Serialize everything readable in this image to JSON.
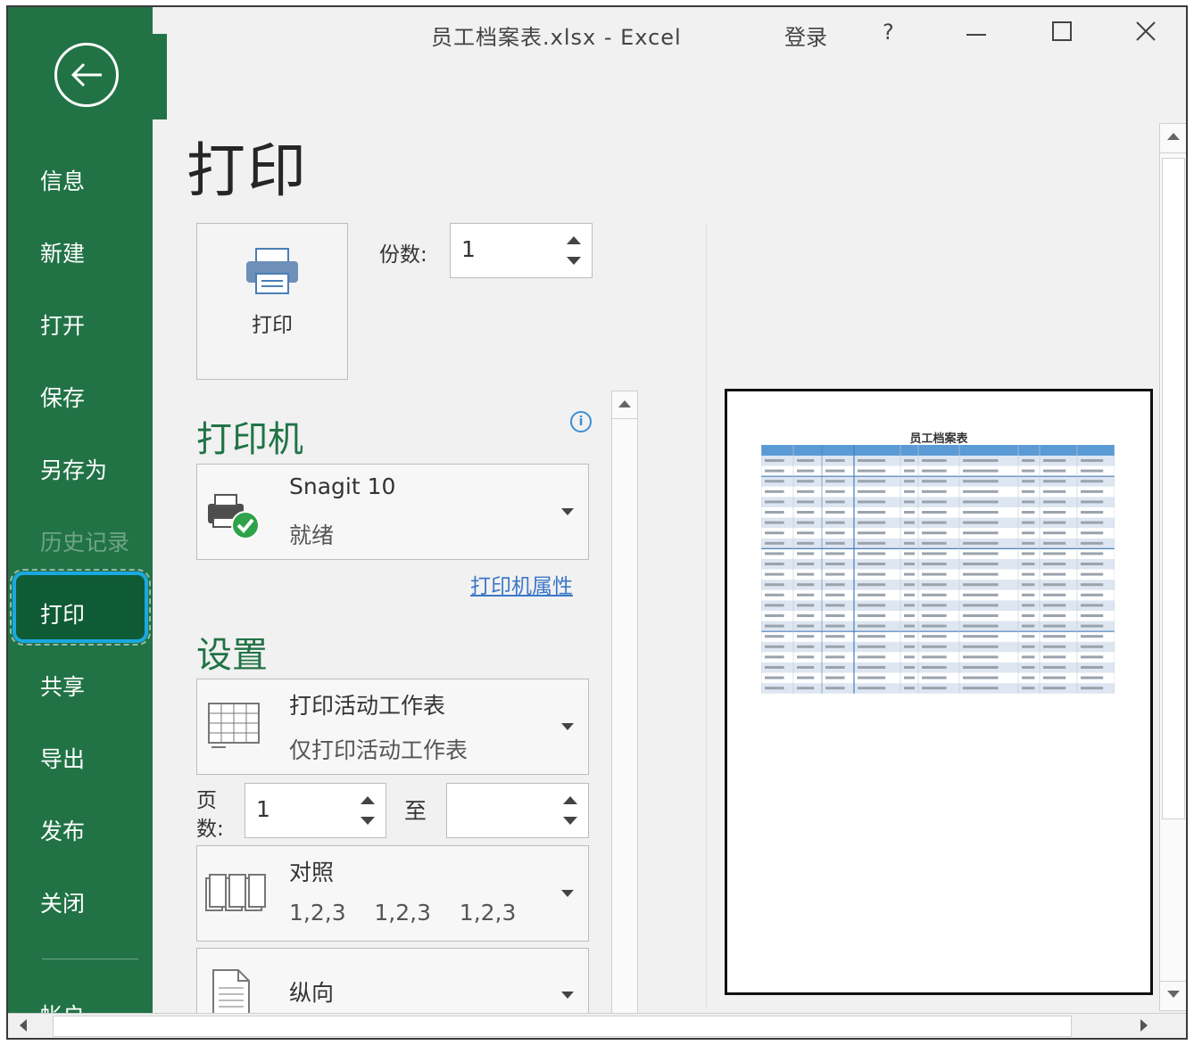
{
  "window": {
    "title": "员工档案表.xlsx  -  Excel",
    "login": "登录",
    "help": "?",
    "minimize_icon": "minimize-icon",
    "maximize_icon": "maximize-icon",
    "close_icon": "close-icon"
  },
  "sidebar": {
    "back_icon": "back-arrow-icon",
    "items": [
      {
        "label": "信息",
        "disabled": false
      },
      {
        "label": "新建",
        "disabled": false
      },
      {
        "label": "打开",
        "disabled": false
      },
      {
        "label": "保存",
        "disabled": false
      },
      {
        "label": "另存为",
        "disabled": false
      },
      {
        "label": "历史记录",
        "disabled": true
      },
      {
        "label": "打印",
        "active": true
      },
      {
        "label": "共享",
        "disabled": false
      },
      {
        "label": "导出",
        "disabled": false
      },
      {
        "label": "发布",
        "disabled": false
      },
      {
        "label": "关闭",
        "disabled": false
      }
    ],
    "account_partial": "帐户",
    "accent_color": "#217346",
    "active_color": "#0f5b35",
    "focus_ring_color": "#1aa8e0"
  },
  "main": {
    "heading": "打印",
    "print_button_label": "打印",
    "copies_label": "份数:",
    "copies_value": "1",
    "printer": {
      "section_title": "打印机",
      "name": "Snagit 10",
      "status": "就绪",
      "properties_link": "打印机属性"
    },
    "settings": {
      "section_title": "设置",
      "scope_title": "打印活动工作表",
      "scope_desc": "仅打印活动工作表",
      "pages_label_line1": "页",
      "pages_label_line2": "数:",
      "pages_from": "1",
      "pages_to_label": "至",
      "pages_to": "",
      "collate_title": "对照",
      "collate_desc": "1,2,3    1,2,3    1,2,3",
      "orientation": "纵向"
    }
  },
  "preview": {
    "title": "员工档案表"
  }
}
